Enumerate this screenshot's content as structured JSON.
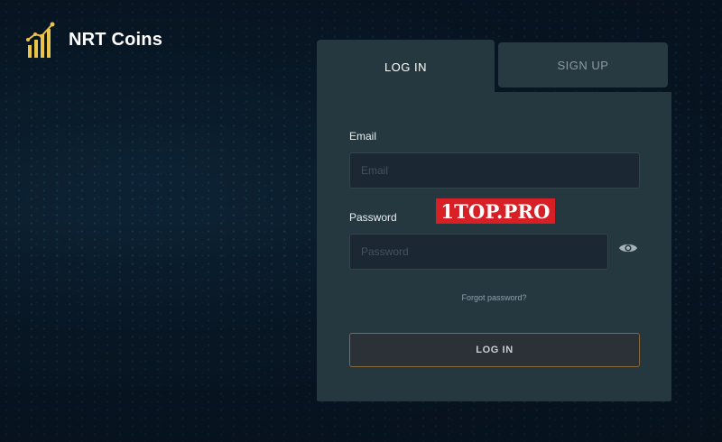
{
  "brand": {
    "name": "NRT Coins",
    "icon": "chart-growth-icon",
    "accent": "#e8c44a"
  },
  "tabs": [
    {
      "label": "LOG IN",
      "active": true
    },
    {
      "label": "SIGN UP",
      "active": false
    }
  ],
  "form": {
    "email_label": "Email",
    "email_placeholder": "Email",
    "email_value": "",
    "password_label": "Password",
    "password_placeholder": "Password",
    "password_value": "",
    "show_password_icon": "eye-icon",
    "forgot_label": "Forgot password?",
    "submit_label": "LOG IN",
    "submit_border_color": "#8a6a3c"
  },
  "watermark": {
    "text": "1TOP.PRO",
    "color": "#d81f26"
  }
}
